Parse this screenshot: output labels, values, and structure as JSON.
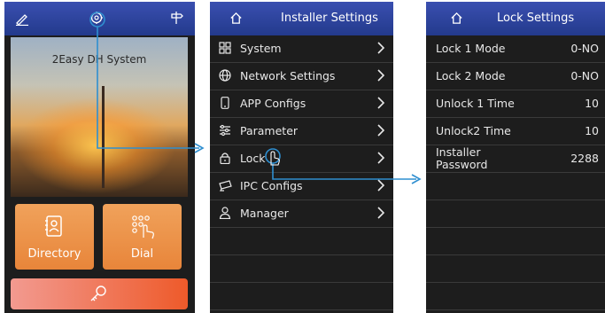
{
  "screen_home": {
    "top_icons": [
      "pen-icon",
      "gear-icon",
      "signpost-icon"
    ],
    "photo_title": "2Easy DH System",
    "tiles": [
      {
        "label": "Directory",
        "icon": "contacts-icon"
      },
      {
        "label": "Dial",
        "icon": "dialpad-icon"
      }
    ],
    "unlock_icon": "key-icon"
  },
  "screen_installer": {
    "title": "Installer Settings",
    "items": [
      {
        "label": "System",
        "icon": "grid-icon"
      },
      {
        "label": "Network Settings",
        "icon": "globe-icon"
      },
      {
        "label": "APP Configs",
        "icon": "phone-icon"
      },
      {
        "label": "Parameter",
        "icon": "sliders-icon"
      },
      {
        "label": "Lock",
        "icon": "lock-icon"
      },
      {
        "label": "IPC Configs",
        "icon": "camera-icon"
      },
      {
        "label": "Manager",
        "icon": "manager-icon"
      }
    ]
  },
  "screen_lock": {
    "title": "Lock Settings",
    "items": [
      {
        "label": "Lock 1 Mode",
        "value": "0-NO"
      },
      {
        "label": "Lock 2 Mode",
        "value": "0-NO"
      },
      {
        "label": "Unlock 1 Time",
        "value": "10"
      },
      {
        "label": "Unlock2 Time",
        "value": "10"
      },
      {
        "label": "Installer",
        "label2": "Password",
        "value": "2288"
      }
    ]
  },
  "colors": {
    "header_blue": "#233a8c",
    "tile_orange": "#e8853a",
    "connector_blue": "#2f8fd0",
    "screen_bg": "#1d1d1d"
  }
}
